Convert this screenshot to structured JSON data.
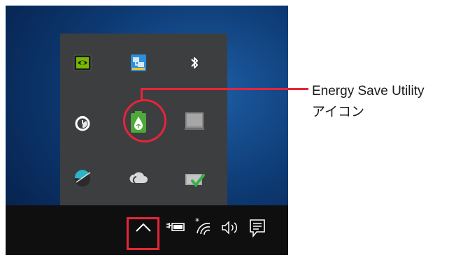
{
  "callout": {
    "title": "Energy Save Utility",
    "subtitle": "アイコン"
  },
  "tray_icons": [
    {
      "name": "nvidia-icon"
    },
    {
      "name": "network-sharing-icon"
    },
    {
      "name": "bluetooth-icon"
    },
    {
      "name": "timer-app-icon"
    },
    {
      "name": "energy-save-utility-icon"
    },
    {
      "name": "display-icon"
    },
    {
      "name": "comet-app-icon"
    },
    {
      "name": "cloud-icon"
    },
    {
      "name": "device-checkmark-icon"
    }
  ],
  "taskbar": {
    "items": [
      "chevron-up-icon",
      "power-icon",
      "wifi-icon",
      "volume-icon",
      "action-center-icon"
    ]
  },
  "colors": {
    "highlight": "#e8243a",
    "popup_bg": "#3d3e40",
    "taskbar_bg": "#0f0f0f"
  }
}
